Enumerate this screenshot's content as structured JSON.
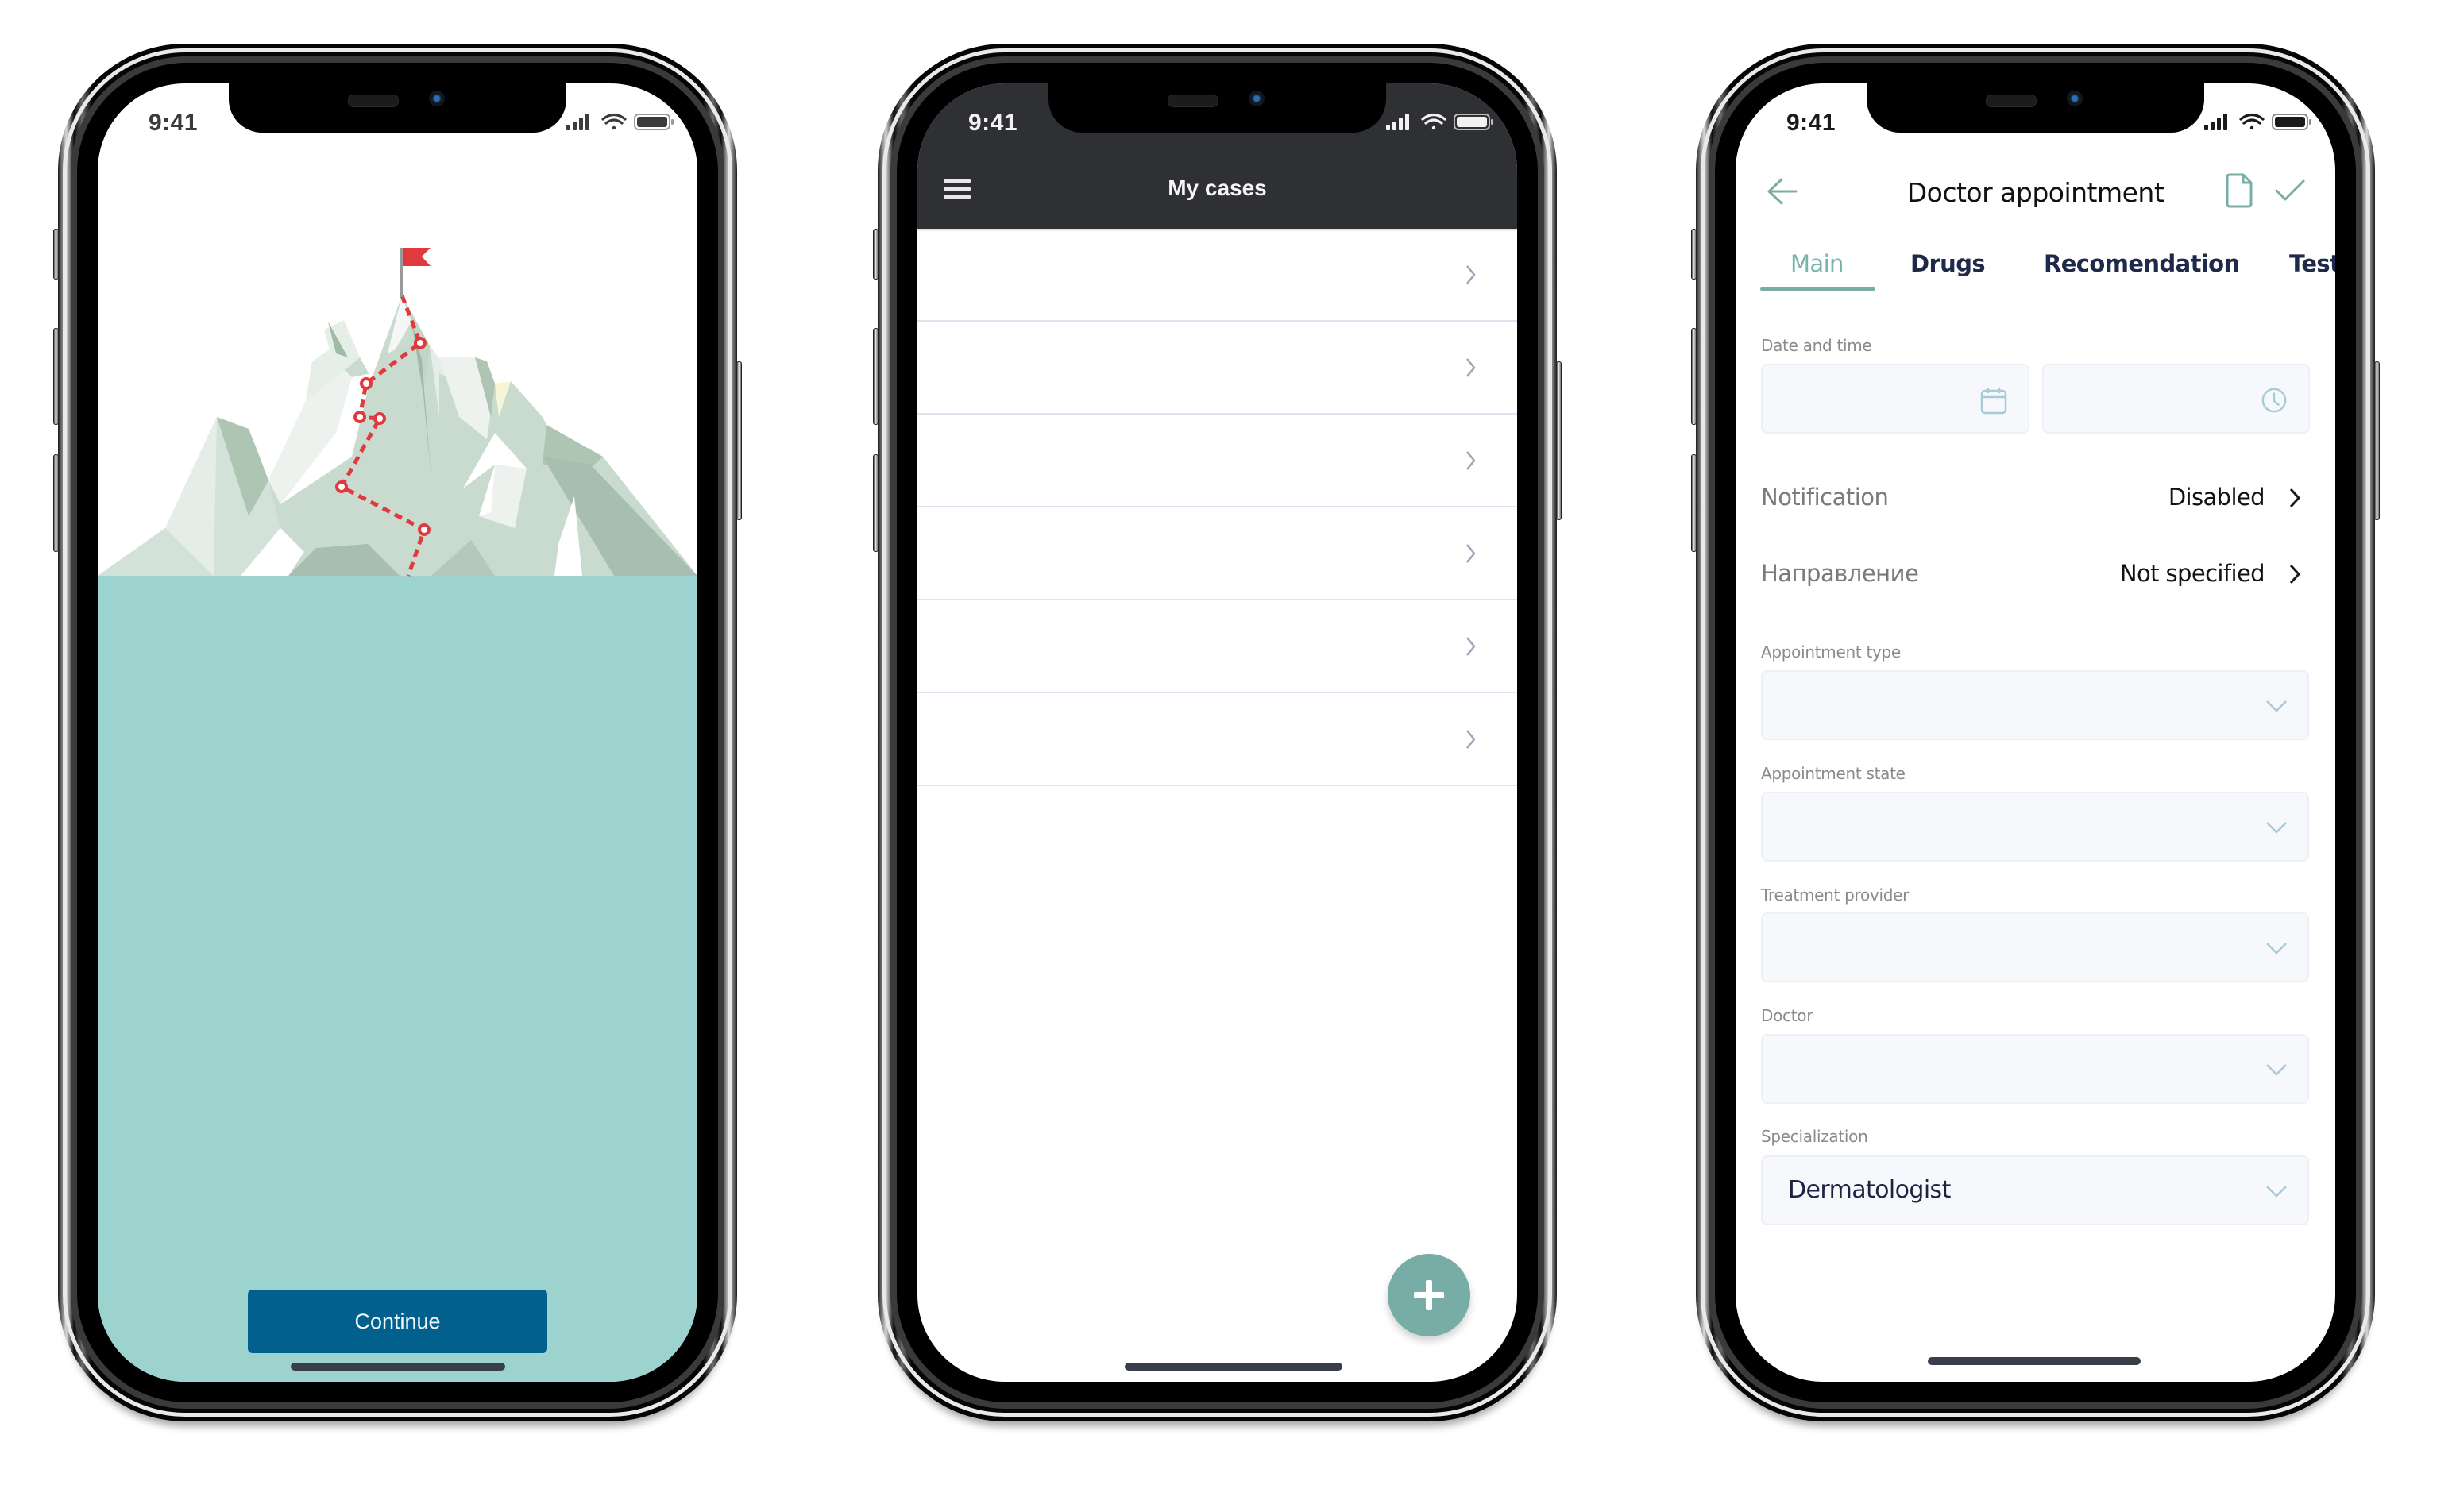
{
  "status_bar": {
    "time": "9:41"
  },
  "colors": {
    "accent_teal": "#79aea6",
    "onboarding_background": "#9dd3cf",
    "primary_button": "#02608f",
    "header_dark": "#2f3034",
    "flag_red": "#e0393e"
  },
  "onboarding": {
    "illustration": "mountain-with-flag-and-route",
    "continue_label": "Continue"
  },
  "cases": {
    "title": "My cases",
    "menu_icon": "hamburger-icon",
    "rows": [
      {
        "label": "",
        "chevron": "chevron-right-icon"
      },
      {
        "label": "",
        "chevron": "chevron-right-icon"
      },
      {
        "label": "",
        "chevron": "chevron-right-icon"
      },
      {
        "label": "",
        "chevron": "chevron-right-icon"
      },
      {
        "label": "",
        "chevron": "chevron-right-icon"
      },
      {
        "label": "",
        "chevron": "chevron-right-icon"
      }
    ],
    "fab_icon": "plus-icon"
  },
  "appointment": {
    "title": "Doctor appointment",
    "icons": {
      "back": "arrow-left-icon",
      "document": "document-icon",
      "save": "check-icon"
    },
    "tabs": [
      {
        "label": "Main",
        "active": true
      },
      {
        "label": "Drugs",
        "active": false
      },
      {
        "label": "Recomendation",
        "active": false
      },
      {
        "label": "Test",
        "active": false
      }
    ],
    "date_time": {
      "label": "Date and time",
      "date_value": "",
      "time_value": ""
    },
    "notification": {
      "label": "Notification",
      "value": "Disabled"
    },
    "direction": {
      "label": "Направление",
      "value": "Not specified"
    },
    "fields": [
      {
        "label": "Appointment type",
        "value": ""
      },
      {
        "label": "Appointment state",
        "value": ""
      },
      {
        "label": "Treatment provider",
        "value": ""
      },
      {
        "label": "Doctor",
        "value": ""
      },
      {
        "label": "Specialization",
        "value": "Dermatologist"
      }
    ]
  }
}
